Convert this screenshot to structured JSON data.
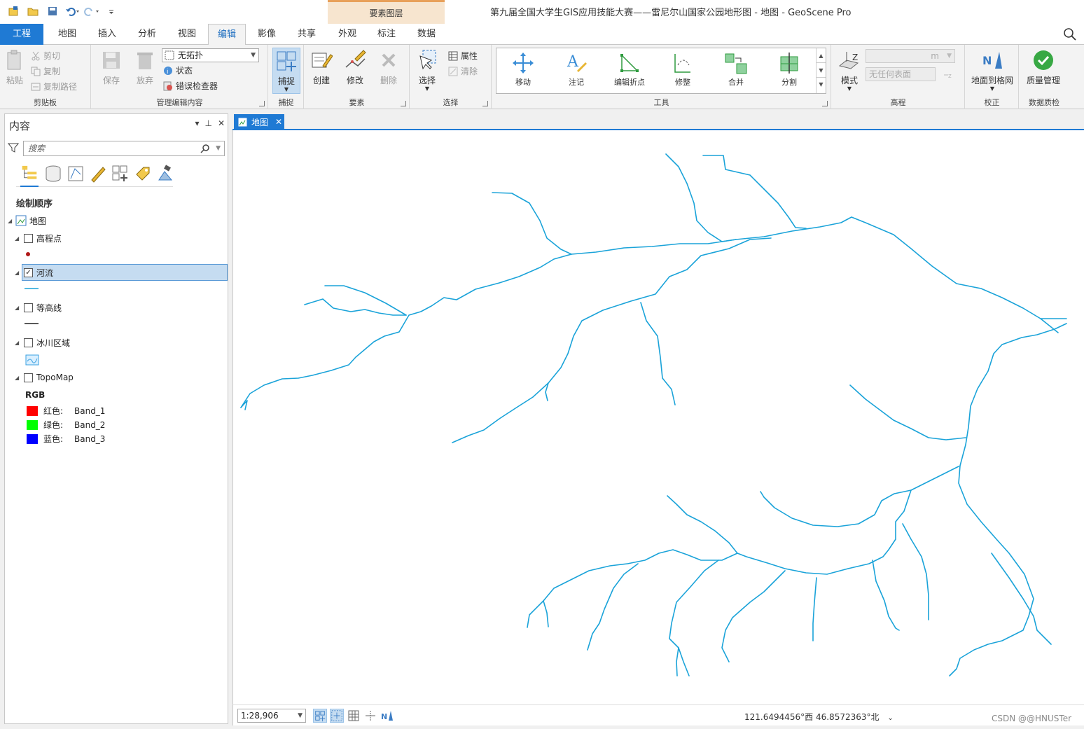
{
  "window_title": "第九届全国大学生GIS应用技能大赛——雷尼尔山国家公园地形图 - 地图 - GeoScene Pro",
  "context_tab_group": "要素图层",
  "tabs": {
    "project": "工程",
    "map": "地图",
    "insert": "插入",
    "analysis": "分析",
    "view": "视图",
    "edit": "编辑",
    "imagery": "影像",
    "share": "共享",
    "appearance": "外观",
    "labeling": "标注",
    "data": "数据"
  },
  "ribbon": {
    "clipboard": {
      "paste": "粘贴",
      "cut": "剪切",
      "copy": "复制",
      "copy_path": "复制路径",
      "group": "剪贴板"
    },
    "manage": {
      "save": "保存",
      "discard": "放弃",
      "topology_value": "无拓扑",
      "status": "状态",
      "error_inspector": "错误检查器",
      "group": "管理编辑内容"
    },
    "snapping": {
      "snap": "捕捉",
      "group": "捕捉"
    },
    "features": {
      "create": "创建",
      "modify": "修改",
      "delete": "删除",
      "group": "要素"
    },
    "selection": {
      "select": "选择",
      "attributes": "属性",
      "clear": "清除",
      "group": "选择"
    },
    "tools": {
      "move": "移动",
      "annotate": "注记",
      "edit_vertices": "编辑折点",
      "reshape": "修整",
      "merge": "合并",
      "split": "分割",
      "group": "工具"
    },
    "elevation": {
      "mode": "模式",
      "unit": "m",
      "surface_placeholder": "无任何表面",
      "group": "高程"
    },
    "georef": {
      "ground_to_grid": "地面到格网",
      "group": "校正"
    },
    "dq": {
      "quality": "质量管理",
      "group": "数据质检"
    }
  },
  "contents": {
    "title": "内容",
    "search_placeholder": "搜索",
    "draw_order": "绘制顺序",
    "map_name": "地图",
    "layers": [
      {
        "name": "高程点",
        "checked": false
      },
      {
        "name": "河流",
        "checked": true
      },
      {
        "name": "等高线",
        "checked": false
      },
      {
        "name": "冰川区域",
        "checked": false
      },
      {
        "name": "TopoMap",
        "checked": false
      }
    ],
    "rgb_label": "RGB",
    "bands": [
      {
        "channel": "红色:",
        "band": "Band_1",
        "color": "#ff0000"
      },
      {
        "channel": "绿色:",
        "band": "Band_2",
        "color": "#00ff00"
      },
      {
        "channel": "蓝色:",
        "band": "Band_3",
        "color": "#0000ff"
      }
    ]
  },
  "map_view": {
    "tab_label": "地图",
    "river_color": "#1aa3d9",
    "scale": "1:28,906",
    "coordinates": "121.6494456°西 46.8572363°北"
  },
  "watermark": "CSDN @@HNUSTer"
}
